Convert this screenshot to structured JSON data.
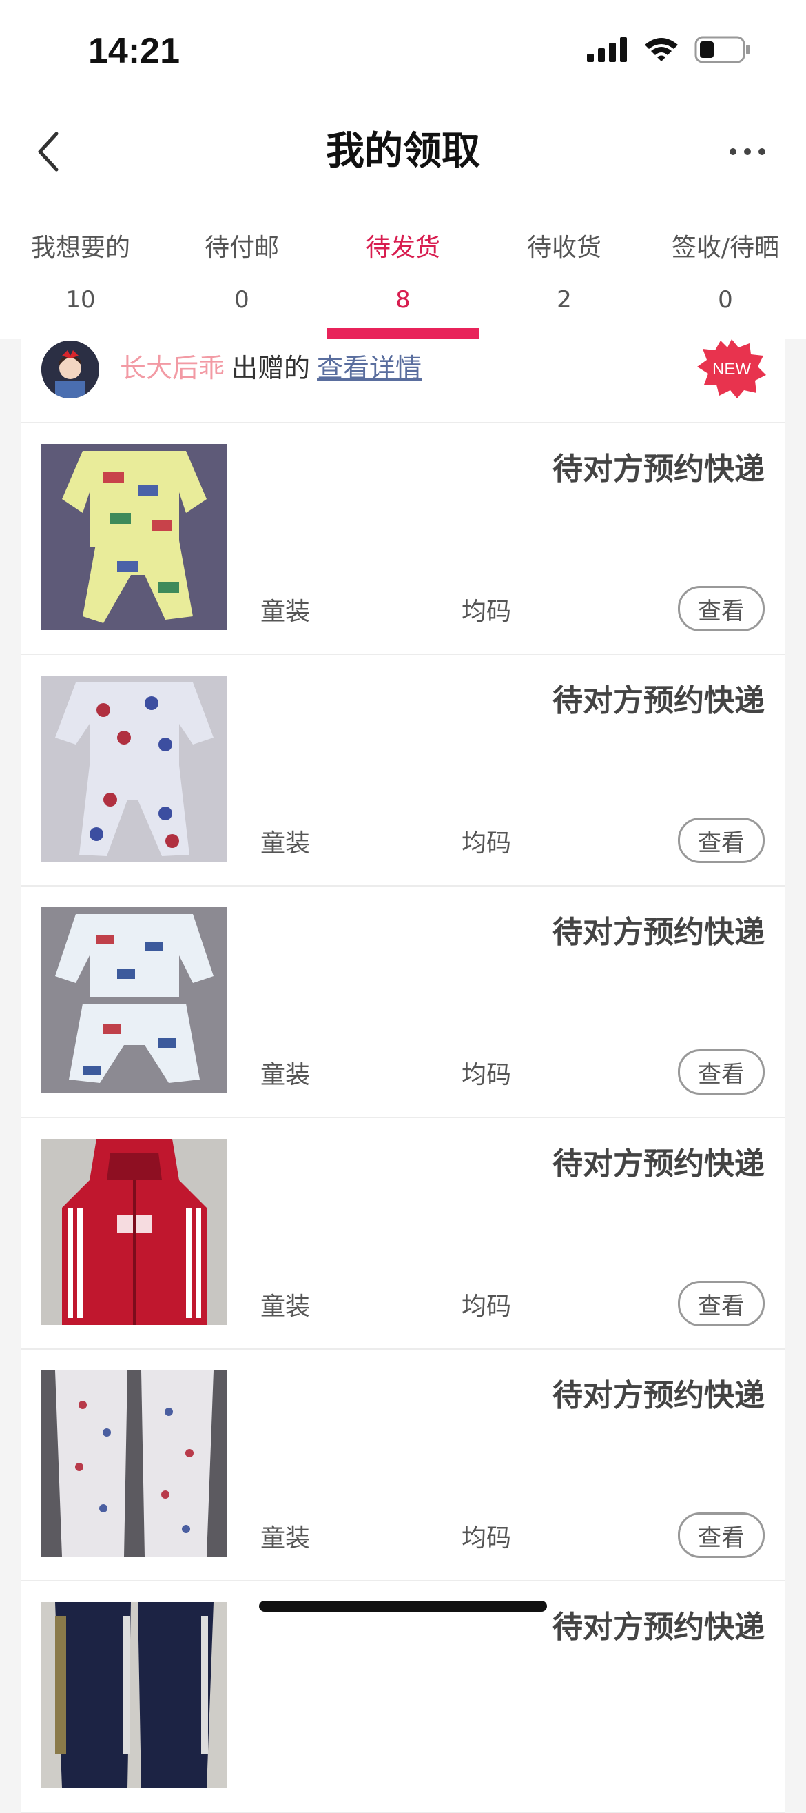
{
  "status_bar": {
    "time": "14:21"
  },
  "header": {
    "title": "我的领取"
  },
  "tabs": [
    {
      "label": "我想要的",
      "count": "10",
      "active": false
    },
    {
      "label": "待付邮",
      "count": "0",
      "active": false
    },
    {
      "label": "待发货",
      "count": "8",
      "active": true
    },
    {
      "label": "待收货",
      "count": "2",
      "active": false
    },
    {
      "label": "签收/待晒",
      "count": "0",
      "active": false
    }
  ],
  "giver": {
    "name": "长大后乖",
    "action": "出赠的",
    "link": "查看详情",
    "badge": "NEW"
  },
  "items": [
    {
      "status": "待对方预约快递",
      "category": "童装",
      "size": "均码",
      "button": "查看",
      "thumb": "yellow-car-pajamas"
    },
    {
      "status": "待对方预约快递",
      "category": "童装",
      "size": "均码",
      "button": "查看",
      "thumb": "print-pajamas"
    },
    {
      "status": "待对方预约快递",
      "category": "童装",
      "size": "均码",
      "button": "查看",
      "thumb": "white-car-pajamas"
    },
    {
      "status": "待对方预约快递",
      "category": "童装",
      "size": "均码",
      "button": "查看",
      "thumb": "red-down-jacket"
    },
    {
      "status": "待对方预约快递",
      "category": "童装",
      "size": "均码",
      "button": "查看",
      "thumb": "heart-print-pants"
    },
    {
      "status": "待对方预约快递",
      "category": "",
      "size": "",
      "button": "",
      "thumb": "navy-track-pants"
    }
  ],
  "colors": {
    "accent": "#e8235a",
    "giver_name": "#f29aa4",
    "link": "#5a6e9e"
  }
}
